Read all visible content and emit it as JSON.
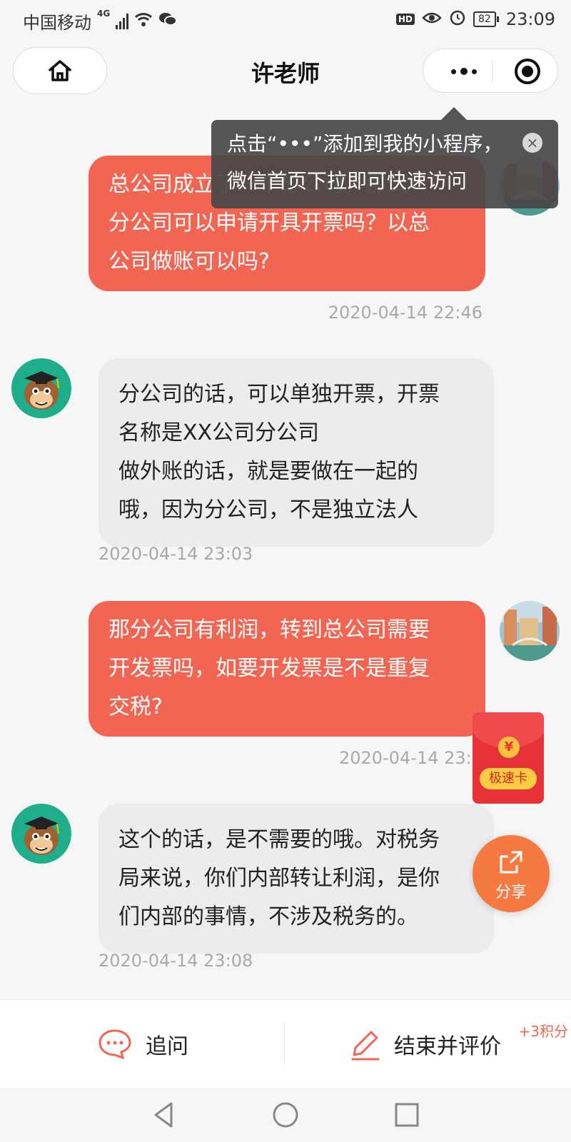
{
  "status_bar": {
    "carrier": "中国移动",
    "network": "4G",
    "hd": "HD",
    "battery": "82",
    "time": "23:09"
  },
  "header": {
    "title": "许老师",
    "home_icon": "home-icon",
    "more_icon": "more-dots-icon",
    "close_icon": "target-close-icon"
  },
  "tooltip": {
    "line1": "点击“•••”添加到我的小程序，",
    "line2": "微信首页下拉即可快速访问"
  },
  "messages": [
    {
      "from": "me",
      "text": "总公司成立了一个分公司，那么分公司可以申请开具开票吗？以总公司做账可以吗?",
      "time": "2020-04-14 22:46",
      "lines": [
        "总公司成立了一个分公司，那么",
        "分公司可以申请开具开票吗？以总",
        "公司做账可以吗?"
      ]
    },
    {
      "from": "them",
      "time": "2020-04-14 23:03",
      "lines": [
        "分公司的话，可以单独开票，开票",
        "名称是XX公司分公司",
        "做外账的话，就是要做在一起的",
        "哦，因为分公司，不是独立法人"
      ]
    },
    {
      "from": "me",
      "time": "2020-04-14 23:0",
      "lines": [
        "那分公司有利润，转到总公司需要",
        "开发票吗，如要开发票是不是重复",
        "交税?"
      ]
    },
    {
      "from": "them",
      "time": "2020-04-14 23:08",
      "lines": [
        "这个的话，是不需要的哦。对税务",
        "局来说，你们内部转让利润，是你",
        "们内部的事情，不涉及税务的。"
      ]
    }
  ],
  "red_packet": {
    "coin": "¥",
    "label": "极速卡"
  },
  "share": {
    "label": "分享"
  },
  "actions": {
    "ask_label": "追问",
    "finish_label": "结束并评价",
    "points": "+3积分"
  },
  "colors": {
    "accent": "#f26552",
    "them_bubble": "#ececec",
    "timestamp": "#a9a9a9"
  }
}
